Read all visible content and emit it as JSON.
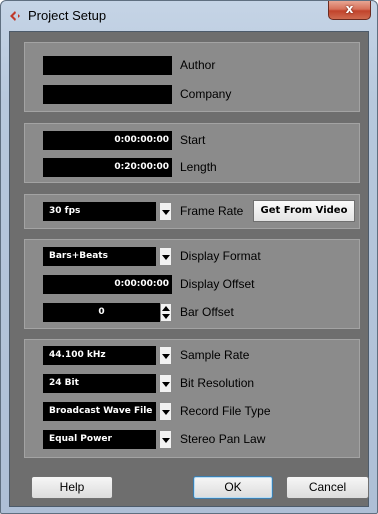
{
  "window": {
    "title": "Project Setup",
    "close_label": "x"
  },
  "fields": {
    "author_value": "",
    "author_label": "Author",
    "company_value": "",
    "company_label": "Company",
    "start_value": "0:00:00:00",
    "start_label": "Start",
    "length_value": "0:20:00:00",
    "length_label": "Length",
    "frame_rate_value": "30 fps",
    "frame_rate_label": "Frame Rate",
    "get_from_video_label": "Get From Video",
    "display_format_value": "Bars+Beats",
    "display_format_label": "Display Format",
    "display_offset_value": "0:00:00:00",
    "display_offset_label": "Display Offset",
    "bar_offset_value": "0",
    "bar_offset_label": "Bar Offset",
    "sample_rate_value": "44.100 kHz",
    "sample_rate_label": "Sample Rate",
    "bit_resolution_value": "24 Bit",
    "bit_resolution_label": "Bit Resolution",
    "record_file_type_value": "Broadcast Wave File",
    "record_file_type_label": "Record File Type",
    "stereo_pan_law_value": "Equal Power",
    "stereo_pan_law_label": "Stereo Pan Law"
  },
  "buttons": {
    "help": "Help",
    "ok": "OK",
    "cancel": "Cancel"
  },
  "colors": {
    "panel": "#6e6e6e",
    "group": "#8b8b8b",
    "field": "#000000",
    "close": "#c1432b"
  },
  "icons": {
    "app": "cubase-logo-icon",
    "close": "close-icon"
  }
}
